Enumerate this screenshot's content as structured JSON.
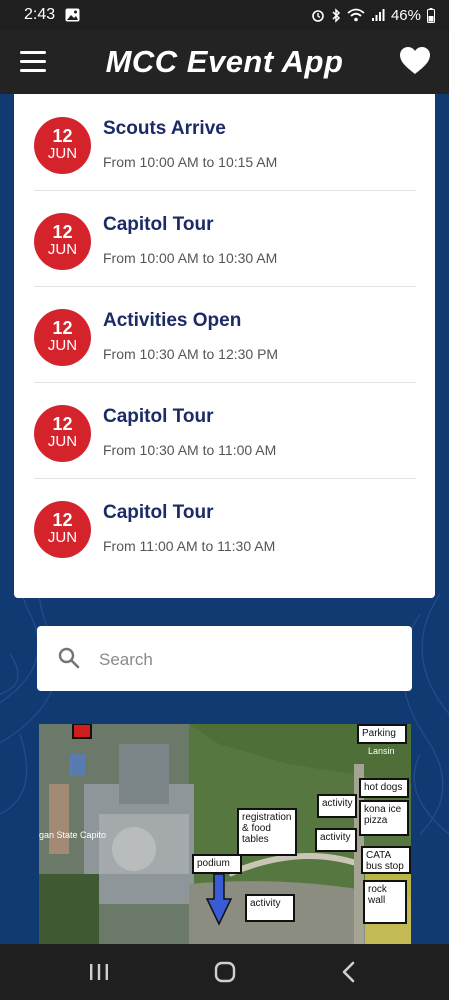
{
  "status_bar": {
    "time": "2:43",
    "battery": "46%"
  },
  "app_bar": {
    "title": "MCC Event App"
  },
  "events": [
    {
      "day": "12",
      "month": "JUN",
      "title": "Scouts Arrive",
      "time": "From 10:00 AM to 10:15 AM"
    },
    {
      "day": "12",
      "month": "JUN",
      "title": "Capitol Tour",
      "time": "From 10:00 AM to 10:30 AM"
    },
    {
      "day": "12",
      "month": "JUN",
      "title": "Activities Open",
      "time": "From 10:30 AM to 12:30 PM"
    },
    {
      "day": "12",
      "month": "JUN",
      "title": "Capitol Tour",
      "time": "From 10:30 AM to 11:00 AM"
    },
    {
      "day": "12",
      "month": "JUN",
      "title": "Capitol Tour",
      "time": "From 11:00 AM to 11:30 AM"
    }
  ],
  "search": {
    "placeholder": "Search"
  },
  "map": {
    "labels": {
      "parking": "Parking",
      "lansing": "Lansin",
      "hot_dogs": "hot dogs",
      "kona": "kona ice\npizza",
      "activity_1": "activity",
      "activity_2": "activity",
      "activity_3": "activity",
      "registration": "registration\n& food\ntables",
      "podium": "podium",
      "cata": "CATA\nbus stop",
      "rock_wall": "rock\nwall",
      "capitol": "gan State Capito"
    }
  },
  "colors": {
    "accent_red": "#d4232b",
    "title_navy": "#1c2a66",
    "background_blue": "#113a73",
    "app_bar": "#232323"
  }
}
